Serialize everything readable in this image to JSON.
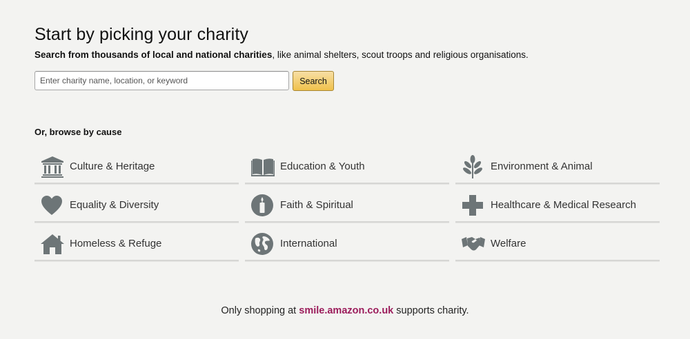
{
  "header": {
    "title": "Start by picking your charity",
    "subtitle_bold": "Search from thousands of local and national charities",
    "subtitle_rest": ", like animal shelters, scout troops and religious organisations."
  },
  "search": {
    "placeholder": "Enter charity name, location, or keyword",
    "value": "",
    "button_label": "Search"
  },
  "browse": {
    "heading": "Or, browse by cause",
    "causes": [
      {
        "label": "Culture & Heritage",
        "icon": "museum-icon"
      },
      {
        "label": "Education & Youth",
        "icon": "book-icon"
      },
      {
        "label": "Environment & Animal",
        "icon": "leaf-icon"
      },
      {
        "label": "Equality & Diversity",
        "icon": "heart-icon"
      },
      {
        "label": "Faith & Spiritual",
        "icon": "candle-icon"
      },
      {
        "label": "Healthcare & Medical Research",
        "icon": "medical-cross-icon"
      },
      {
        "label": "Homeless & Refuge",
        "icon": "house-icon"
      },
      {
        "label": "International",
        "icon": "globe-icon"
      },
      {
        "label": "Welfare",
        "icon": "handshake-icon"
      }
    ],
    "icon_color": "#6d7577"
  },
  "footer": {
    "prefix": "Only shopping at ",
    "link": "smile.amazon.co.uk",
    "suffix": " supports charity.",
    "link_color": "#9b1c5b"
  }
}
